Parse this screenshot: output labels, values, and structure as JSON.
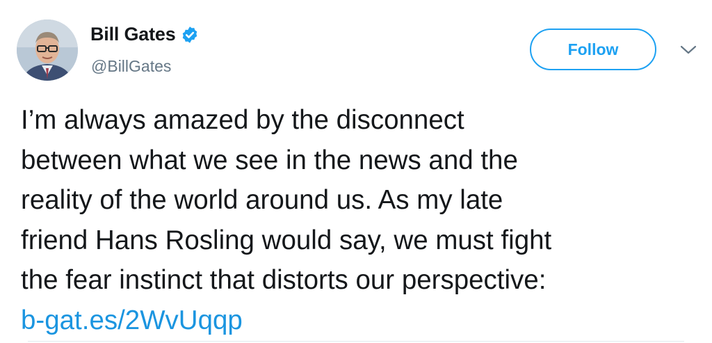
{
  "tweet": {
    "author": {
      "display_name": "Bill Gates",
      "handle": "@BillGates",
      "verified": true,
      "avatar_icon": "profile-photo"
    },
    "follow_label": "Follow",
    "menu_icon": "chevron-down-icon",
    "text": "I’m always amazed by the disconnect\nbetween what we see in the news and the\nreality of the world around us. As my late\nfriend Hans Rosling would say, we must fight\nthe fear instinct that distorts our perspective:\n",
    "link": "b-gat.es/2WvUqqp"
  },
  "colors": {
    "accent": "#1da1f2",
    "link": "#1b95e0",
    "text": "#14171a",
    "secondary_text": "#657786"
  }
}
